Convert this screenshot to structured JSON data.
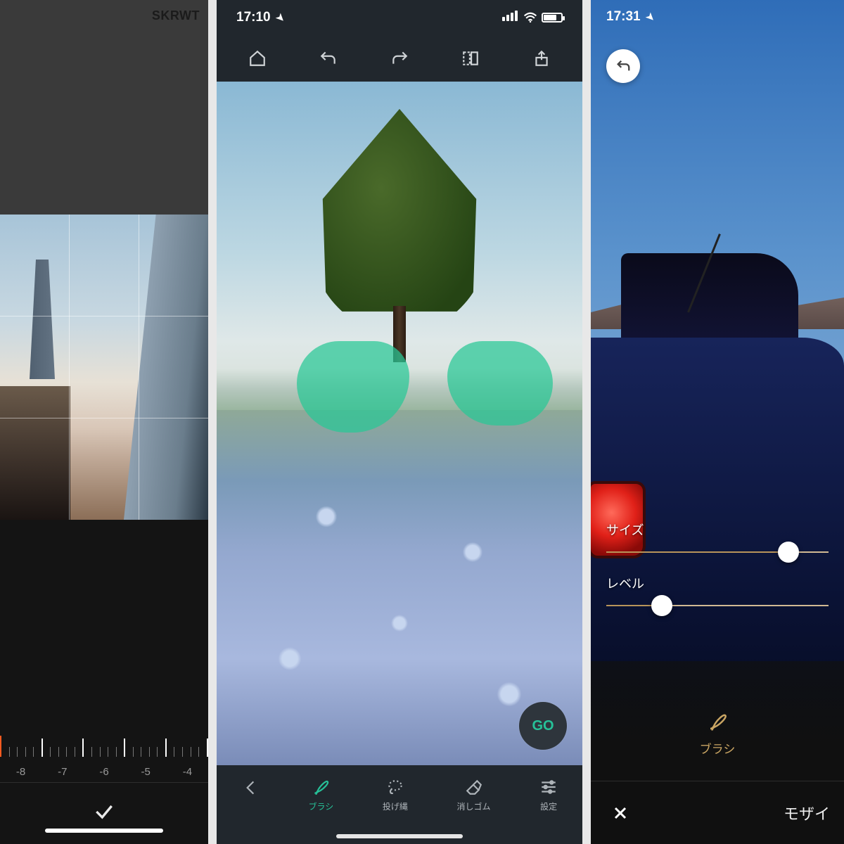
{
  "left": {
    "brand": "SKRWT",
    "slider_ticks": [
      "-8",
      "-7",
      "-6",
      "-5",
      "-4"
    ]
  },
  "center": {
    "status_time": "17:10",
    "go_label": "GO",
    "tabs": {
      "brush": "ブラシ",
      "lasso": "投げ縄",
      "eraser": "消しゴム",
      "settings": "設定"
    }
  },
  "right": {
    "status_time": "17:31",
    "size_label": "サイズ",
    "level_label": "レベル",
    "size_value": 82,
    "level_value": 25,
    "brush_label": "ブラシ",
    "tool_title": "モザイ"
  }
}
